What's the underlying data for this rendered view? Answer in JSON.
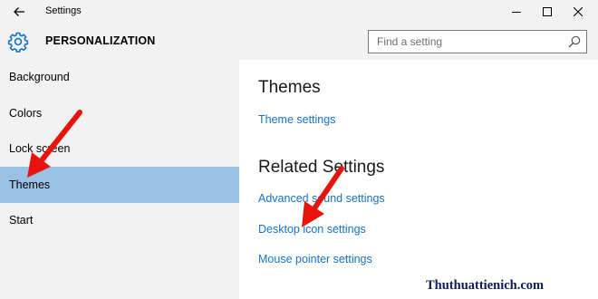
{
  "window": {
    "title": "Settings",
    "controls": {
      "back": "back-arrow",
      "minimize": "minimize",
      "maximize": "maximize",
      "close": "close"
    }
  },
  "header": {
    "icon": "gear-icon",
    "title": "PERSONALIZATION",
    "search": {
      "placeholder": "Find a setting",
      "value": ""
    }
  },
  "sidebar": {
    "selected_color": "#99c2e6",
    "items": [
      {
        "label": "Background",
        "selected": false
      },
      {
        "label": "Colors",
        "selected": false
      },
      {
        "label": "Lock screen",
        "selected": false
      },
      {
        "label": "Themes",
        "selected": true
      },
      {
        "label": "Start",
        "selected": false
      }
    ]
  },
  "content": {
    "themes_heading": "Themes",
    "theme_settings_link": "Theme settings",
    "related_heading": "Related Settings",
    "related_links": [
      "Advanced sound settings",
      "Desktop icon settings",
      "Mouse pointer settings"
    ],
    "link_color": "#1673c7"
  },
  "annotations": {
    "arrow_color": "#ff0000"
  },
  "watermark": "Thuthuattienich.com"
}
